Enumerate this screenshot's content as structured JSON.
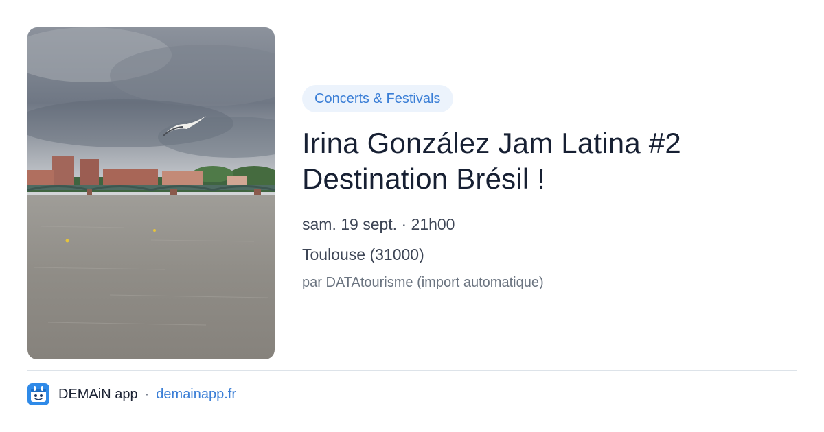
{
  "event": {
    "category": "Concerts & Festivals",
    "title_line1": "Irina González Jam Latina #2",
    "title_line2": "Destination Brésil !",
    "datetime": "sam. 19 sept. · 21h00",
    "location": "Toulouse (31000)",
    "source": "par DATAtourisme (import automatique)"
  },
  "footer": {
    "app_name": "DEMAiN app",
    "separator": "·",
    "url": "demainapp.fr"
  },
  "colors": {
    "accent": "#3a7ed6",
    "badge_bg": "#ecf3fc",
    "title": "#172033",
    "body": "#3e4656",
    "muted": "#6b7480",
    "divider": "#dde3e9"
  },
  "icons": {
    "app_logo": "demain-app-logo-icon"
  }
}
